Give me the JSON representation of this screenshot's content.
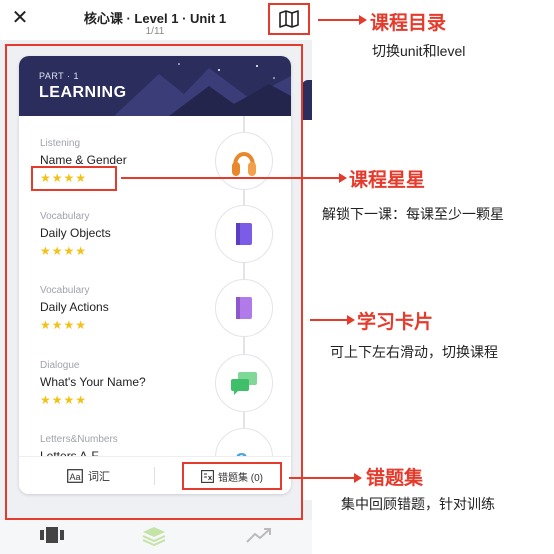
{
  "header": {
    "close_glyph": "✕",
    "title": "核心课 · Level 1 · Unit 1",
    "page_indicator": "1/11"
  },
  "section": {
    "part": "PART · 1",
    "title": "LEARNING"
  },
  "lessons": [
    {
      "category": "Listening",
      "name": "Name & Gender",
      "stars": "★★★★",
      "icon": "headphones-icon",
      "color": "#e8882a"
    },
    {
      "category": "Vocabulary",
      "name": "Daily Objects",
      "stars": "★★★★",
      "icon": "book-icon",
      "color": "#7b5ce6"
    },
    {
      "category": "Vocabulary",
      "name": "Daily Actions",
      "stars": "★★★★",
      "icon": "book-icon",
      "color": "#b07ae8"
    },
    {
      "category": "Dialogue",
      "name": "What's Your Name?",
      "stars": "★★★★",
      "icon": "chat-bubbles-icon",
      "color": "#3fbf6a"
    },
    {
      "category": "Letters&Numbers",
      "name": "Letters A-F",
      "stars": "",
      "icon": "letters-icon",
      "color": "#4aa8e0"
    }
  ],
  "footer": {
    "vocab_label": "词汇",
    "mistakes_label": "错题集 (0)"
  },
  "annotations": [
    {
      "title": "课程目录",
      "desc": "切换unit和level"
    },
    {
      "title": "课程星星",
      "desc": "解锁下一课：每课至少一颗星"
    },
    {
      "title": "学习卡片",
      "desc": "可上下左右滑动，切换课程"
    },
    {
      "title": "错题集",
      "desc": "集中回顾错题，针对训练"
    }
  ],
  "colors": {
    "annotation_red": "#e53b2c",
    "card_header": "#2b2d5c",
    "star": "#f2c21a"
  }
}
